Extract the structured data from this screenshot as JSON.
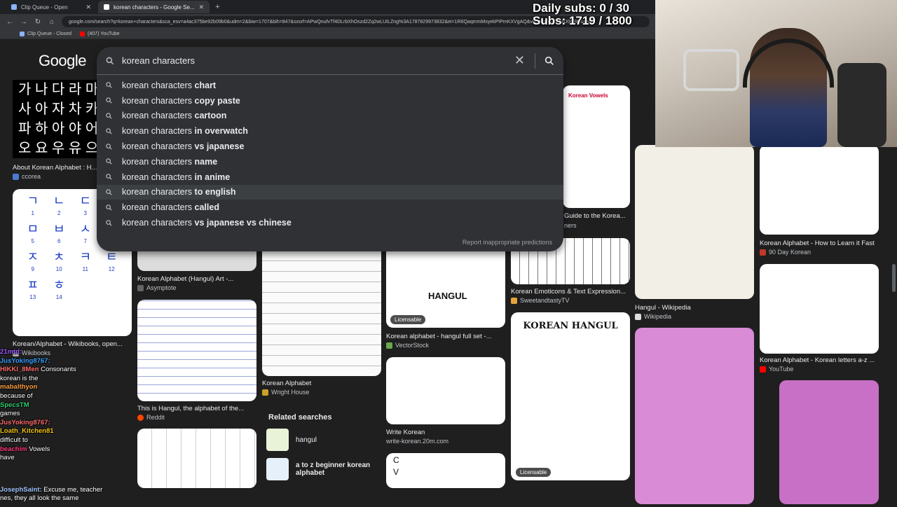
{
  "browser": {
    "tabs": [
      {
        "label": "Clip Queue - Open",
        "active": false
      },
      {
        "label": "korean characters - Google Se...",
        "active": true
      }
    ],
    "url": "google.com/search?q=korean+characters&sca_esv=a4ac375be92b09b0&udm=2&biw=1707&bih=847&sxsrf=APwQnufvTf4DLrbXhOszd2Zq2wLUILZng%3A1787829973832&ei=1R6QaqmmMsyekPIPmKXVgAQ&ved=0ahUKEwjD0CBE&uact=",
    "bookmarks": [
      "Clip Queue - Closed",
      "(407) YouTube"
    ]
  },
  "google": {
    "logo": "Google",
    "query": "korean characters",
    "suggestions": [
      {
        "prefix": "korean characters ",
        "bold": "chart"
      },
      {
        "prefix": "korean characters ",
        "bold": "copy paste"
      },
      {
        "prefix": "korean characters ",
        "bold": "cartoon"
      },
      {
        "prefix": "korean characters ",
        "bold": "in overwatch"
      },
      {
        "prefix": "korean characters ",
        "bold": "vs japanese"
      },
      {
        "prefix": "korean characters ",
        "bold": "name"
      },
      {
        "prefix": "korean characters ",
        "bold": "in anime"
      },
      {
        "prefix": "korean characters ",
        "bold": "to english"
      },
      {
        "prefix": "korean characters ",
        "bold": "called"
      },
      {
        "prefix": "korean characters ",
        "bold": "vs japanese vs chinese"
      }
    ],
    "report": "Report inappropriate predictions"
  },
  "results": {
    "black_rows": [
      "가 나 다 라 마",
      "사 아 자 차 카",
      "파 하 아 야 어",
      "오 요 우 유 으"
    ],
    "cards": [
      {
        "caption": "About Korean Alphabet : H...",
        "source": "ccorea"
      },
      {
        "caption": "Korean/Alphabet - Wikibooks, open...",
        "source": "Wikibooks"
      },
      {
        "caption": "Korean Alphabet (Hangul) Art -...",
        "source": "Asymptote"
      },
      {
        "caption": "This is Hangul, the alphabet of the...",
        "source": "Reddit"
      },
      {
        "caption": "Korean Alphabet",
        "source": "Wright House"
      },
      {
        "caption": "Korean alphabet - hangul full set -...",
        "source": "VectorStock"
      },
      {
        "caption": "Write Korean",
        "source": "write-korean.20m.com"
      },
      {
        "caption": "Korean Emoticons & Text Expression...",
        "source": "SweetandtastyTV"
      },
      {
        "caption": "Guide to the Korea...",
        "source": "ners"
      },
      {
        "caption": "Hangul - Wikipedia",
        "source": "Wikipedia"
      },
      {
        "caption": "Korean Alphabet - How to Learn it Fast",
        "source": "90 Day Korean"
      },
      {
        "caption": "Korean Alphabet - Korean letters a-z ...",
        "source": "YouTube"
      }
    ],
    "jamo": [
      {
        "ch": "ㄱ",
        "n": "1"
      },
      {
        "ch": "ㄴ",
        "n": "2"
      },
      {
        "ch": "ㄷ",
        "n": "3"
      },
      {
        "ch": "",
        "n": ""
      },
      {
        "ch": "ㅁ",
        "n": "5"
      },
      {
        "ch": "ㅂ",
        "n": "6"
      },
      {
        "ch": "ㅅ",
        "n": "7"
      },
      {
        "ch": "",
        "n": ""
      },
      {
        "ch": "ㅈ",
        "n": "9"
      },
      {
        "ch": "ㅊ",
        "n": "10"
      },
      {
        "ch": "ㅋ",
        "n": "11"
      },
      {
        "ch": "ㅌ",
        "n": "12"
      },
      {
        "ch": "ㅍ",
        "n": "13"
      },
      {
        "ch": "ㅎ",
        "n": "14"
      },
      {
        "ch": "",
        "n": ""
      },
      {
        "ch": "",
        "n": ""
      }
    ],
    "licensable": "Licensable",
    "korean_vowels": "Korean Vowels",
    "korean_hangul": "KOREAN HANGUL",
    "hangul_script": "HANGUL",
    "cv": [
      "C",
      "V"
    ],
    "related": {
      "title": "Related searches",
      "items": [
        "hangul",
        "a to z beginner korean alphabet"
      ]
    }
  },
  "stream": {
    "daily_subs": "Daily subs: 0 / 30",
    "subs": "Subs: 1719 / 1800",
    "chat": [
      {
        "user": "21mtd:",
        "msg": ""
      },
      {
        "user": "JusYoking8767:",
        "msg": ""
      },
      {
        "user": "HIKKI_8Men",
        "msg": "Consonants"
      },
      {
        "user": "",
        "msg": "korean is the"
      },
      {
        "user": "mabalthyon",
        "msg": ""
      },
      {
        "user": "",
        "msg": "because of"
      },
      {
        "user": "SpecsTM",
        "msg": ""
      },
      {
        "user": "",
        "msg": "games"
      },
      {
        "user": "JusYoking8767:",
        "msg": ""
      },
      {
        "user": "Loath_Kitchen81",
        "msg": ""
      },
      {
        "user": "",
        "msg": "difficult to"
      },
      {
        "user": "beachim",
        "msg": "Vowels"
      },
      {
        "user": "",
        "msg": "have"
      }
    ],
    "bottom_user": "JosephSaint:",
    "bottom_msg": "Excuse me, teacher",
    "bottom_line2": "nes, they all look the same"
  }
}
